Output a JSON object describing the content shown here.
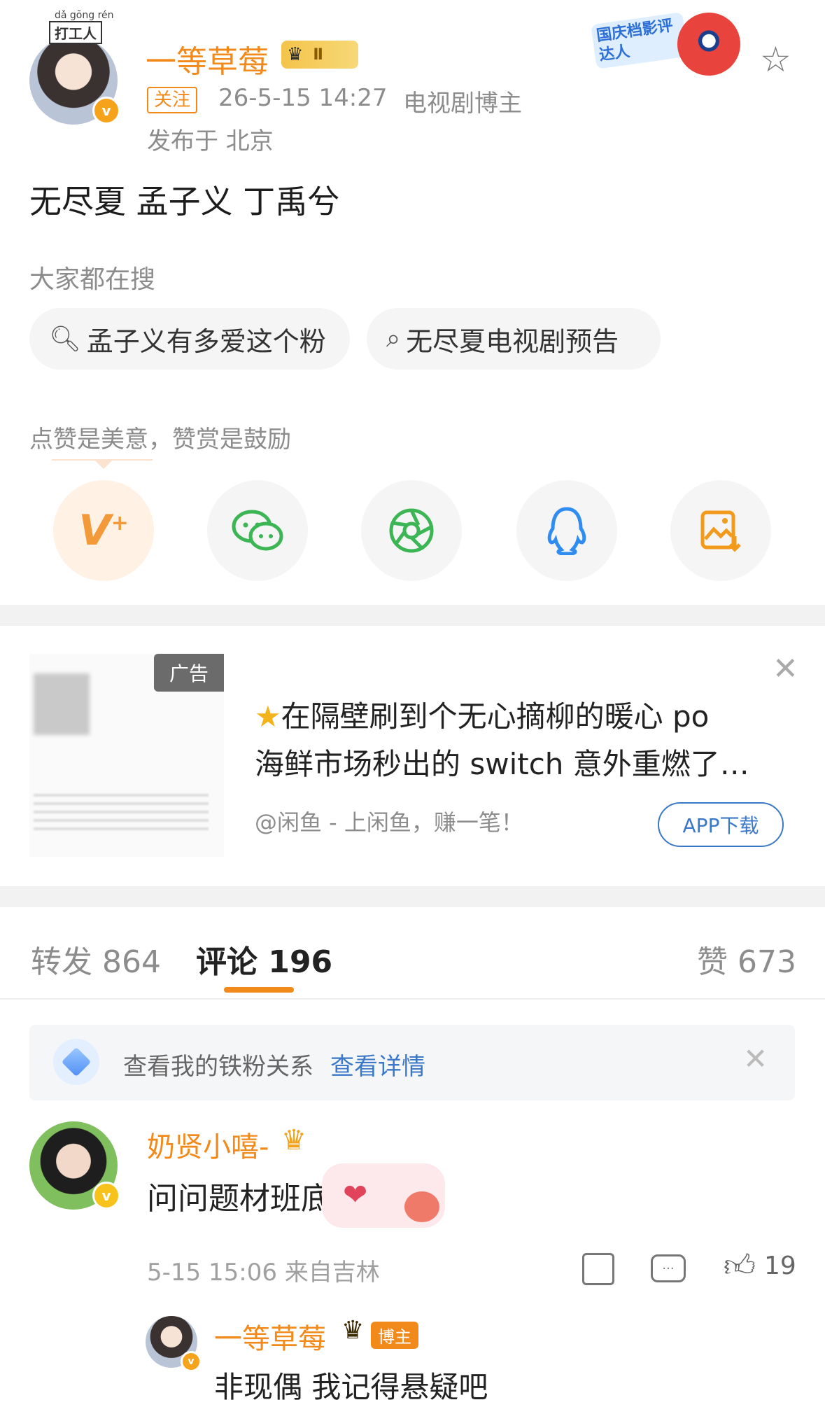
{
  "post": {
    "author_name": "一等草莓",
    "author_tag": "打工人",
    "author_tag_pinyin": "dǎ gōng rén",
    "level_badge": "Ⅱ",
    "follow_label": "关注",
    "timestamp": "26-5-15 14:27",
    "role": "电视剧博主",
    "location": "发布于 北京",
    "event_badge": "国庆档影评达人",
    "content": "无尽夏 孟子义 丁禹兮"
  },
  "search": {
    "heading": "大家都在搜",
    "items": [
      {
        "label": "孟子义有多爱这个粉",
        "icon": "hot-search-icon"
      },
      {
        "label": "无尽夏电视剧预告",
        "icon": "search-icon"
      }
    ]
  },
  "reward": {
    "heading": "点赞是美意，赞赏是鼓励",
    "share_buttons": [
      {
        "name": "vplus-icon",
        "color": "#f29a3a"
      },
      {
        "name": "wechat-icon",
        "color": "#3cb554"
      },
      {
        "name": "moments-icon",
        "color": "#3cb554"
      },
      {
        "name": "qq-icon",
        "color": "#2f8cf0"
      },
      {
        "name": "save-image-icon",
        "color": "#f29a1b"
      }
    ]
  },
  "ad": {
    "badge": "广告",
    "line1": "在隔壁刷到个无心摘柳的暖心 po",
    "line2": "海鲜市场秒出的 switch 意外重燃了…",
    "source": "@闲鱼 - 上闲鱼，赚一笔！",
    "cta": "APP下载"
  },
  "tabs": {
    "repost_label": "转发",
    "repost_count": "864",
    "comment_label": "评论",
    "comment_count": "196",
    "like_label": "赞",
    "like_count": "673"
  },
  "fan_banner": {
    "text": "查看我的铁粉关系",
    "link": "查看详情"
  },
  "comment": {
    "author": "奶贤小嘻-",
    "text": "问问题材班底",
    "meta": "5-15 15:06 来自吉林",
    "like_count": "19"
  },
  "reply": {
    "author": "一等草莓",
    "badge": "博主",
    "text": "非现偶 我记得悬疑吧"
  },
  "colors": {
    "accent": "#f28a1b",
    "link": "#3b78c7",
    "tab_underline": "#f28a1b"
  }
}
